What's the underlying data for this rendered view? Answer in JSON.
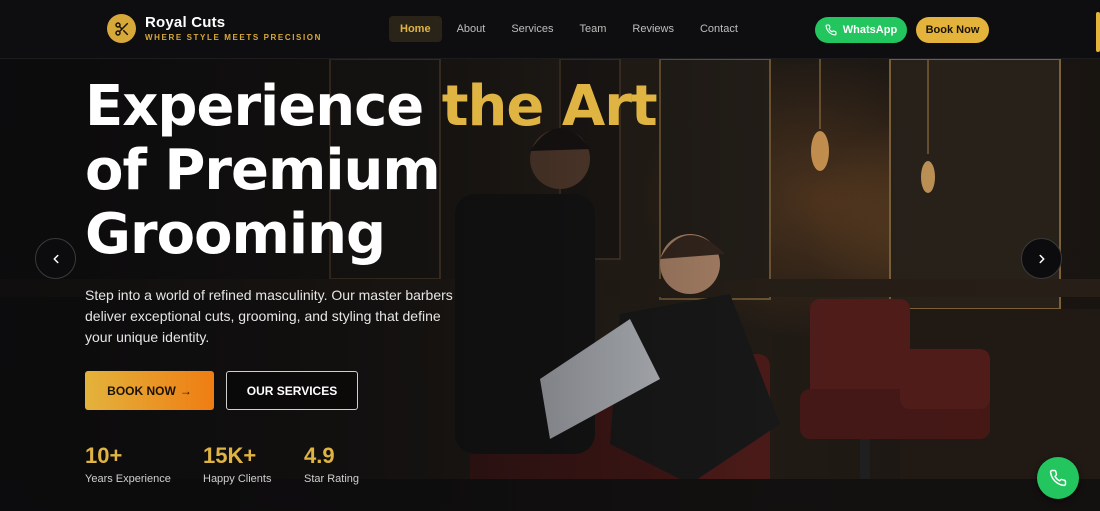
{
  "brand": {
    "name": "Royal Cuts",
    "tagline": "WHERE STYLE MEETS PRECISION",
    "logo_icon": "scissors-icon"
  },
  "nav": {
    "items": [
      {
        "label": "Home",
        "active": true
      },
      {
        "label": "About"
      },
      {
        "label": "Services"
      },
      {
        "label": "Team"
      },
      {
        "label": "Reviews"
      },
      {
        "label": "Contact"
      }
    ],
    "whatsapp_label": "WhatsApp",
    "book_label": "Book Now"
  },
  "hero": {
    "title_part1": "Experience ",
    "title_highlight": "the Art",
    "title_part2": "of Premium",
    "title_part3": "Grooming",
    "description": "Step into a world of refined masculinity. Our master barbers deliver exceptional cuts, grooming, and styling that define your unique identity.",
    "primary_button": "BOOK NOW",
    "primary_arrow": "→",
    "secondary_button": "OUR SERVICES",
    "stats": [
      {
        "value": "10+",
        "label": "Years Experience"
      },
      {
        "value": "15K+",
        "label": "Happy Clients"
      },
      {
        "value": "4.9",
        "label": "Star Rating"
      }
    ]
  },
  "colors": {
    "accent_gold": "#e0b442",
    "whatsapp_green": "#22c55e",
    "dark_bg": "#0e0e10"
  },
  "icons": {
    "prev": "chevron-left-icon",
    "next": "chevron-right-icon",
    "phone": "phone-icon"
  }
}
